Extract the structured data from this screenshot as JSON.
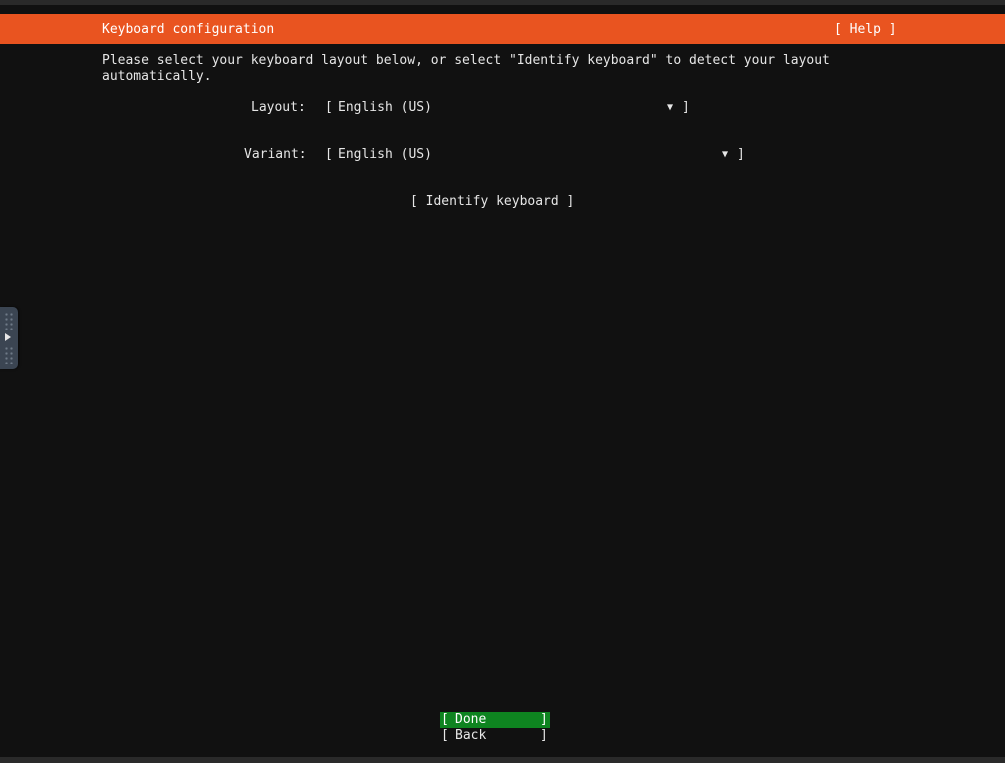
{
  "header": {
    "title": "Keyboard configuration",
    "help_label": "[ Help ]"
  },
  "instructions": "Please select your keyboard layout below, or select \"Identify keyboard\" to detect your layout\nautomatically.",
  "form": {
    "layout_label": "Layout:",
    "layout_value": "English (US)",
    "variant_label": "Variant:",
    "variant_value": "English (US)",
    "bracket_open": "[",
    "bracket_close": "]",
    "dropdown_arrow": "▼"
  },
  "identify_button": "[ Identify keyboard ]",
  "footer": {
    "done": {
      "left": "[",
      "label": "Done",
      "right": "]"
    },
    "back": {
      "left": "[",
      "label": "Back",
      "right": "]"
    }
  },
  "colors": {
    "header_bg": "#e95420",
    "screen_bg": "#111111",
    "active_button_bg": "#0e8420",
    "text": "#e6e6e6"
  },
  "icons": {
    "side_handle": "expand-panel-icon",
    "dropdown": "dropdown-arrow-icon"
  }
}
